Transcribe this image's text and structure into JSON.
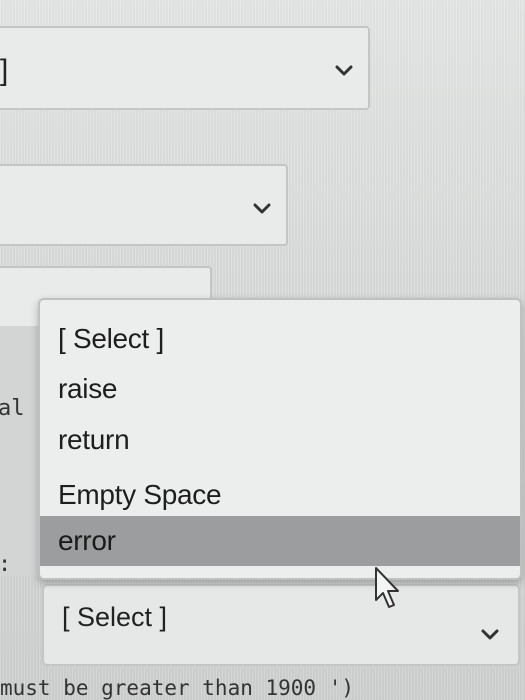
{
  "fields": {
    "first": {
      "value_fragment": "]"
    },
    "side_label_fragment": "al",
    "side_colon": ":"
  },
  "dropdown": {
    "options": [
      "[ Select ]",
      "raise",
      "return",
      "Empty Space",
      "error"
    ],
    "highlighted": "error"
  },
  "bottom_select": {
    "value": "[ Select ]"
  },
  "hint_text": "must be greater than 1900 ')",
  "colors": {
    "highlight": "#9b9d9e",
    "field_bg": "#e9ebea",
    "border": "#c4c6c5"
  },
  "icons": {
    "select_arrow": "chevron-down-icon",
    "pointer": "mouse-cursor-icon"
  }
}
